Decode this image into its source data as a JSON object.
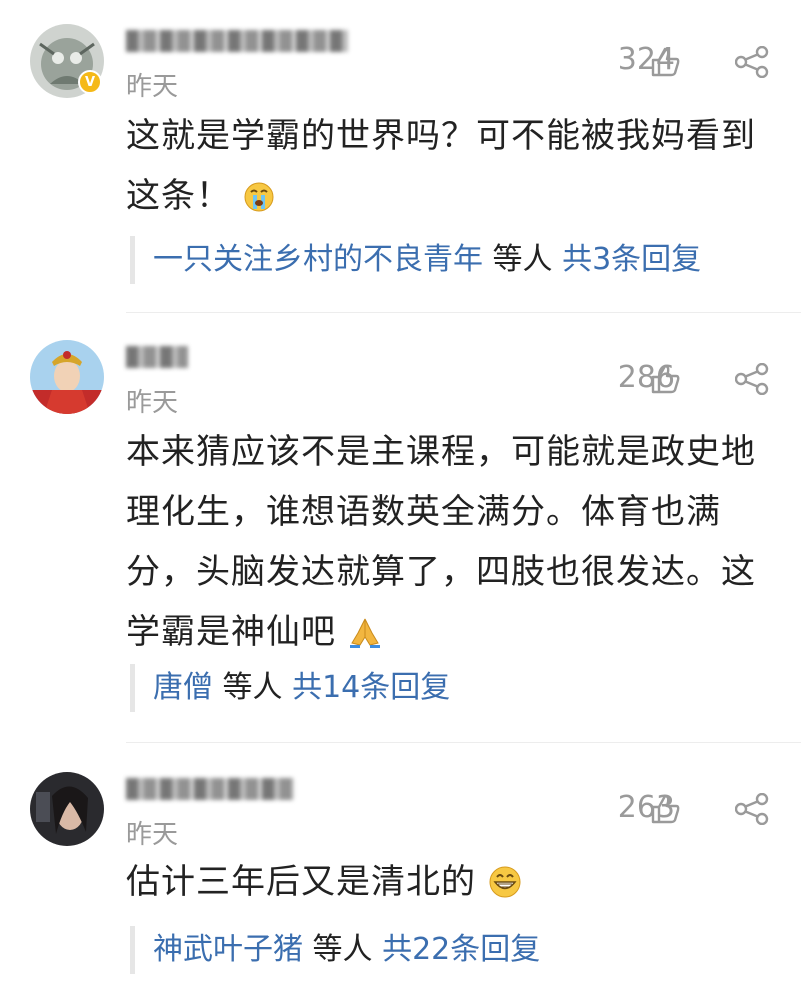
{
  "comments": [
    {
      "time": "昨天",
      "likes": "324",
      "text": "这就是学霸的世界吗？可不能被我妈看到这条！",
      "reply_user": "一只关注乡村的不良青年",
      "reply_mid": " 等人 ",
      "reply_count": "共3条回复",
      "emoji": "crying-face",
      "verified": true
    },
    {
      "time": "昨天",
      "likes": "286",
      "text": "本来猜应该不是主课程，可能就是政史地理化生，谁想语数英全满分。体育也满分，头脑发达就算了，四肢也很发达。这学霸是神仙吧",
      "reply_user": "唐僧",
      "reply_mid": " 等人 ",
      "reply_count": "共14条回复",
      "emoji": "folded-hands"
    },
    {
      "time": "昨天",
      "likes": "263",
      "text": "估计三年后又是清北的",
      "reply_user": "神武叶子猪",
      "reply_mid": " 等人 ",
      "reply_count": "共22条回复",
      "emoji": "grinning-face"
    }
  ],
  "colors": {
    "link": "#3b6eaf",
    "meta": "#9a9a9a",
    "text": "#222222",
    "verified": "#f5b918"
  }
}
